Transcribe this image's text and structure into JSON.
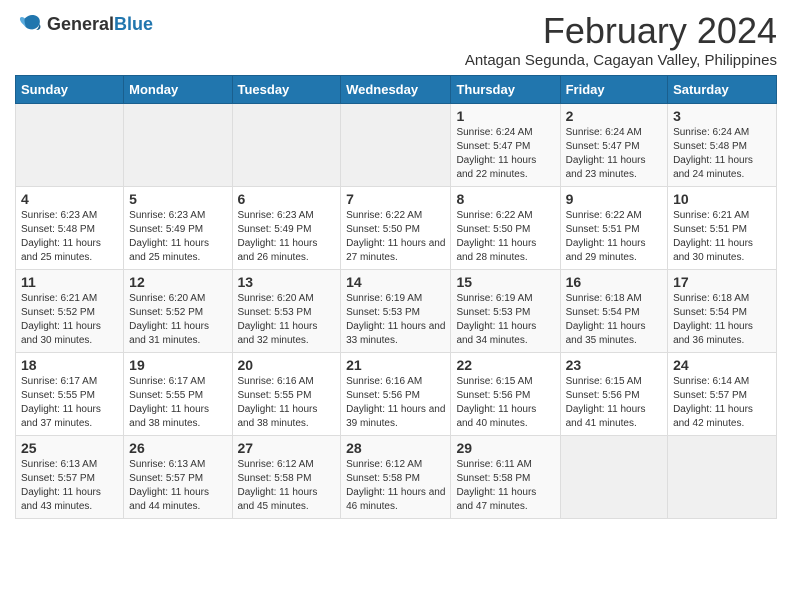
{
  "header": {
    "logo_general": "General",
    "logo_blue": "Blue",
    "month_title": "February 2024",
    "location": "Antagan Segunda, Cagayan Valley, Philippines"
  },
  "days_of_week": [
    "Sunday",
    "Monday",
    "Tuesday",
    "Wednesday",
    "Thursday",
    "Friday",
    "Saturday"
  ],
  "weeks": [
    [
      {
        "day": "",
        "info": ""
      },
      {
        "day": "",
        "info": ""
      },
      {
        "day": "",
        "info": ""
      },
      {
        "day": "",
        "info": ""
      },
      {
        "day": "1",
        "info": "Sunrise: 6:24 AM\nSunset: 5:47 PM\nDaylight: 11 hours and 22 minutes."
      },
      {
        "day": "2",
        "info": "Sunrise: 6:24 AM\nSunset: 5:47 PM\nDaylight: 11 hours and 23 minutes."
      },
      {
        "day": "3",
        "info": "Sunrise: 6:24 AM\nSunset: 5:48 PM\nDaylight: 11 hours and 24 minutes."
      }
    ],
    [
      {
        "day": "4",
        "info": "Sunrise: 6:23 AM\nSunset: 5:48 PM\nDaylight: 11 hours and 25 minutes."
      },
      {
        "day": "5",
        "info": "Sunrise: 6:23 AM\nSunset: 5:49 PM\nDaylight: 11 hours and 25 minutes."
      },
      {
        "day": "6",
        "info": "Sunrise: 6:23 AM\nSunset: 5:49 PM\nDaylight: 11 hours and 26 minutes."
      },
      {
        "day": "7",
        "info": "Sunrise: 6:22 AM\nSunset: 5:50 PM\nDaylight: 11 hours and 27 minutes."
      },
      {
        "day": "8",
        "info": "Sunrise: 6:22 AM\nSunset: 5:50 PM\nDaylight: 11 hours and 28 minutes."
      },
      {
        "day": "9",
        "info": "Sunrise: 6:22 AM\nSunset: 5:51 PM\nDaylight: 11 hours and 29 minutes."
      },
      {
        "day": "10",
        "info": "Sunrise: 6:21 AM\nSunset: 5:51 PM\nDaylight: 11 hours and 30 minutes."
      }
    ],
    [
      {
        "day": "11",
        "info": "Sunrise: 6:21 AM\nSunset: 5:52 PM\nDaylight: 11 hours and 30 minutes."
      },
      {
        "day": "12",
        "info": "Sunrise: 6:20 AM\nSunset: 5:52 PM\nDaylight: 11 hours and 31 minutes."
      },
      {
        "day": "13",
        "info": "Sunrise: 6:20 AM\nSunset: 5:53 PM\nDaylight: 11 hours and 32 minutes."
      },
      {
        "day": "14",
        "info": "Sunrise: 6:19 AM\nSunset: 5:53 PM\nDaylight: 11 hours and 33 minutes."
      },
      {
        "day": "15",
        "info": "Sunrise: 6:19 AM\nSunset: 5:53 PM\nDaylight: 11 hours and 34 minutes."
      },
      {
        "day": "16",
        "info": "Sunrise: 6:18 AM\nSunset: 5:54 PM\nDaylight: 11 hours and 35 minutes."
      },
      {
        "day": "17",
        "info": "Sunrise: 6:18 AM\nSunset: 5:54 PM\nDaylight: 11 hours and 36 minutes."
      }
    ],
    [
      {
        "day": "18",
        "info": "Sunrise: 6:17 AM\nSunset: 5:55 PM\nDaylight: 11 hours and 37 minutes."
      },
      {
        "day": "19",
        "info": "Sunrise: 6:17 AM\nSunset: 5:55 PM\nDaylight: 11 hours and 38 minutes."
      },
      {
        "day": "20",
        "info": "Sunrise: 6:16 AM\nSunset: 5:55 PM\nDaylight: 11 hours and 38 minutes."
      },
      {
        "day": "21",
        "info": "Sunrise: 6:16 AM\nSunset: 5:56 PM\nDaylight: 11 hours and 39 minutes."
      },
      {
        "day": "22",
        "info": "Sunrise: 6:15 AM\nSunset: 5:56 PM\nDaylight: 11 hours and 40 minutes."
      },
      {
        "day": "23",
        "info": "Sunrise: 6:15 AM\nSunset: 5:56 PM\nDaylight: 11 hours and 41 minutes."
      },
      {
        "day": "24",
        "info": "Sunrise: 6:14 AM\nSunset: 5:57 PM\nDaylight: 11 hours and 42 minutes."
      }
    ],
    [
      {
        "day": "25",
        "info": "Sunrise: 6:13 AM\nSunset: 5:57 PM\nDaylight: 11 hours and 43 minutes."
      },
      {
        "day": "26",
        "info": "Sunrise: 6:13 AM\nSunset: 5:57 PM\nDaylight: 11 hours and 44 minutes."
      },
      {
        "day": "27",
        "info": "Sunrise: 6:12 AM\nSunset: 5:58 PM\nDaylight: 11 hours and 45 minutes."
      },
      {
        "day": "28",
        "info": "Sunrise: 6:12 AM\nSunset: 5:58 PM\nDaylight: 11 hours and 46 minutes."
      },
      {
        "day": "29",
        "info": "Sunrise: 6:11 AM\nSunset: 5:58 PM\nDaylight: 11 hours and 47 minutes."
      },
      {
        "day": "",
        "info": ""
      },
      {
        "day": "",
        "info": ""
      }
    ]
  ]
}
